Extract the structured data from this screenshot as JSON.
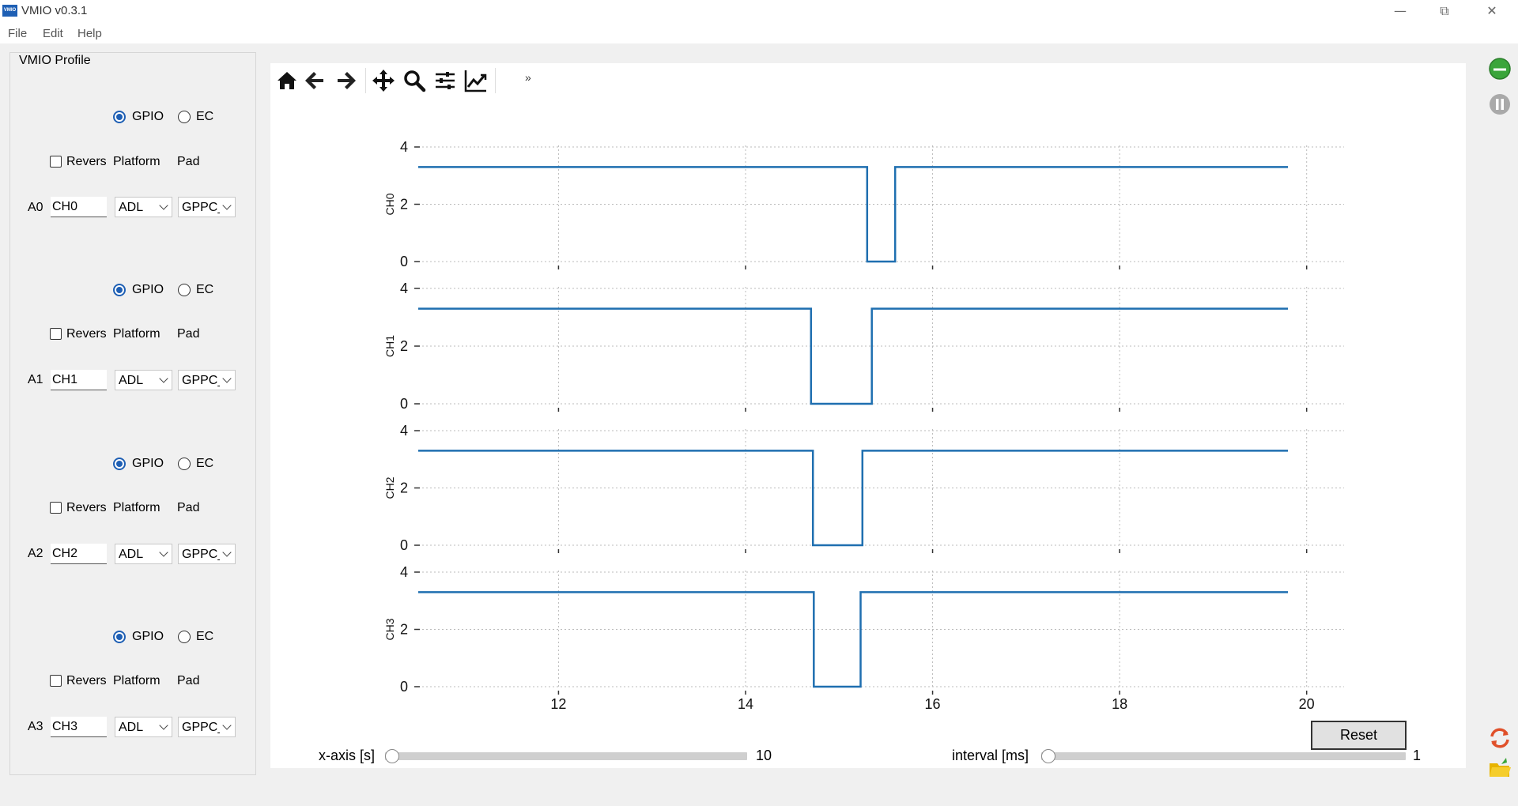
{
  "window": {
    "title": "VMIO v0.3.1",
    "icon_text": "VMIO"
  },
  "menu": [
    "File",
    "Edit",
    "Help"
  ],
  "profile": {
    "title": "VMIO Profile",
    "channels": [
      {
        "gpio_label": "GPIO",
        "ec_label": "EC",
        "mode": "GPIO",
        "reverse_label": "Reverse",
        "reverse_checked": false,
        "platform_label": "Platform",
        "pad_label": "Pad",
        "addr": "A0",
        "name": "CH0",
        "platform": "ADL",
        "pad": "GPPC_"
      },
      {
        "gpio_label": "GPIO",
        "ec_label": "EC",
        "mode": "GPIO",
        "reverse_label": "Reverse",
        "reverse_checked": false,
        "platform_label": "Platform",
        "pad_label": "Pad",
        "addr": "A1",
        "name": "CH1",
        "platform": "ADL",
        "pad": "GPPC_"
      },
      {
        "gpio_label": "GPIO",
        "ec_label": "EC",
        "mode": "GPIO",
        "reverse_label": "Reverse",
        "reverse_checked": false,
        "platform_label": "Platform",
        "pad_label": "Pad",
        "addr": "A2",
        "name": "CH2",
        "platform": "ADL",
        "pad": "GPPC_"
      },
      {
        "gpio_label": "GPIO",
        "ec_label": "EC",
        "mode": "GPIO",
        "reverse_label": "Reverse",
        "reverse_checked": false,
        "platform_label": "Platform",
        "pad_label": "Pad",
        "addr": "A3",
        "name": "CH3",
        "platform": "ADL",
        "pad": "GPPC_"
      }
    ]
  },
  "toolbar": {
    "icons": [
      "home-icon",
      "back-arrow-icon",
      "forward-arrow-icon",
      "pan-icon",
      "zoom-icon",
      "configure-subplots-icon",
      "edit-axis-icon"
    ],
    "more_label": "»"
  },
  "controls": {
    "xaxis_label": "x-axis [s]",
    "xaxis_value": "10",
    "xaxis_fraction": 0,
    "interval_label": "interval [ms]",
    "interval_value": "1",
    "interval_fraction": 0,
    "reset_label": "Reset"
  },
  "side_buttons": [
    "start-icon",
    "pause-icon",
    "refresh-icon",
    "open-folder-icon"
  ],
  "colors": {
    "signal": "#1f6fb0",
    "accent": "#1e5fb4",
    "start": "#3aa53a"
  },
  "chart_data": [
    {
      "type": "line",
      "ylabel": "CH0",
      "xlim": [
        10.5,
        20.4
      ],
      "ylim": [
        0,
        4
      ],
      "yticks": [
        0,
        2,
        4
      ],
      "xticks": [
        12,
        14,
        16,
        18,
        20
      ],
      "grid": true,
      "series": [
        {
          "x": [
            10.5,
            15.3,
            15.3,
            15.6,
            15.6,
            19.8
          ],
          "y": [
            3.3,
            3.3,
            0,
            0,
            3.3,
            3.3
          ]
        }
      ]
    },
    {
      "type": "line",
      "ylabel": "CH1",
      "xlim": [
        10.5,
        20.4
      ],
      "ylim": [
        0,
        4
      ],
      "yticks": [
        0,
        2,
        4
      ],
      "xticks": [
        12,
        14,
        16,
        18,
        20
      ],
      "grid": true,
      "series": [
        {
          "x": [
            10.5,
            14.7,
            14.7,
            15.35,
            15.35,
            19.8
          ],
          "y": [
            3.3,
            3.3,
            0,
            0,
            3.3,
            3.3
          ]
        }
      ]
    },
    {
      "type": "line",
      "ylabel": "CH2",
      "xlim": [
        10.5,
        20.4
      ],
      "ylim": [
        0,
        4
      ],
      "yticks": [
        0,
        2,
        4
      ],
      "xticks": [
        12,
        14,
        16,
        18,
        20
      ],
      "grid": true,
      "series": [
        {
          "x": [
            10.5,
            14.72,
            14.72,
            15.25,
            15.25,
            19.8
          ],
          "y": [
            3.3,
            3.3,
            0,
            0,
            3.3,
            3.3
          ]
        }
      ]
    },
    {
      "type": "line",
      "ylabel": "CH3",
      "xlim": [
        10.5,
        20.4
      ],
      "ylim": [
        0,
        4
      ],
      "yticks": [
        0,
        2,
        4
      ],
      "xticks": [
        12,
        14,
        16,
        18,
        20
      ],
      "xticklabels": [
        "12",
        "14",
        "16",
        "18",
        "20"
      ],
      "grid": true,
      "series": [
        {
          "x": [
            10.5,
            14.73,
            14.73,
            15.23,
            15.23,
            19.8
          ],
          "y": [
            3.3,
            3.3,
            0,
            0,
            3.3,
            3.3
          ]
        }
      ]
    }
  ]
}
